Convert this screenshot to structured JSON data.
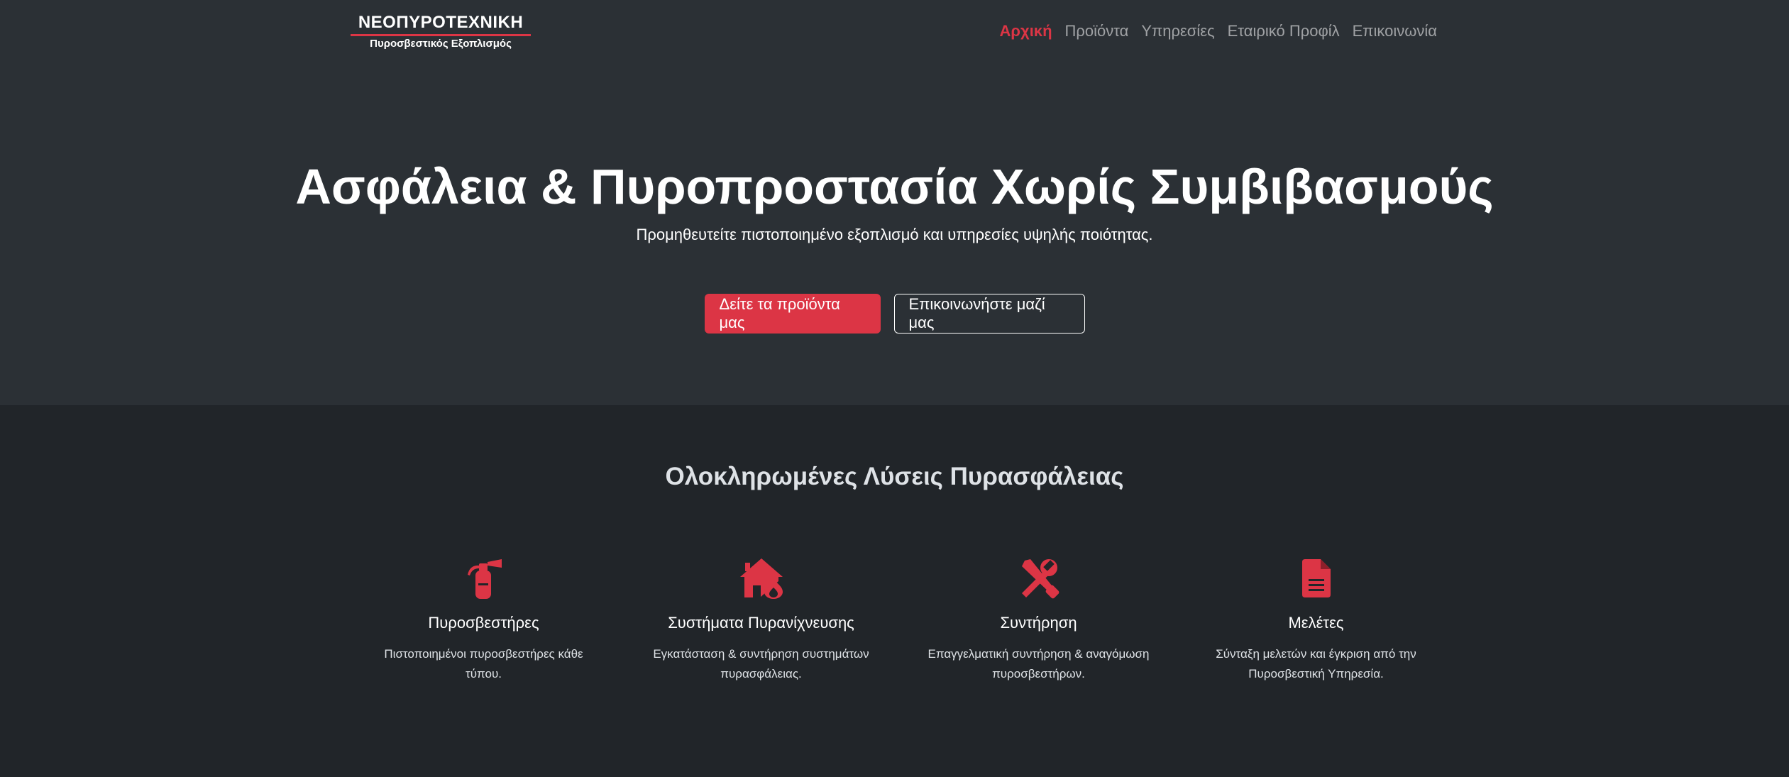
{
  "brand": {
    "name": "ΝΕΟΠΥΡΟΤΕΧΝΙΚΗ",
    "tagline": "Πυροσβεστικός Εξοπλισμός"
  },
  "nav": {
    "items": [
      {
        "label": "Αρχική",
        "active": true
      },
      {
        "label": "Προϊόντα",
        "active": false
      },
      {
        "label": "Υπηρεσίες",
        "active": false
      },
      {
        "label": "Εταιρικό Προφίλ",
        "active": false
      },
      {
        "label": "Επικοινωνία",
        "active": false
      }
    ]
  },
  "hero": {
    "title": "Ασφάλεια & Πυροπροστασία Χωρίς Συμβιβασμούς",
    "subtitle": "Προμηθευτείτε πιστοποιημένο εξοπλισμό και υπηρεσίες υψηλής ποιότητας.",
    "primary_button": "Δείτε τα προϊόντα μας",
    "secondary_button": "Επικοινωνήστε μαζί μας"
  },
  "solutions": {
    "title": "Ολοκληρωμένες Λύσεις Πυρασφάλειας",
    "features": [
      {
        "icon": "fire-extinguisher-icon",
        "title": "Πυροσβεστήρες",
        "description": "Πιστοποιημένοι πυροσβεστήρες κάθε τύπου."
      },
      {
        "icon": "house-fire-icon",
        "title": "Συστήματα Πυρανίχνευσης",
        "description": "Εγκατάσταση & συντήρηση συστημάτων πυρασφάλειας."
      },
      {
        "icon": "tools-icon",
        "title": "Συντήρηση",
        "description": "Επαγγελματική συντήρηση & αναγόμωση πυροσβεστήρων."
      },
      {
        "icon": "file-document-icon",
        "title": "Μελέτες",
        "description": "Σύνταξη μελετών και έγκριση από την Πυροσβεστική Υπηρεσία."
      }
    ]
  },
  "colors": {
    "accent": "#dc3545",
    "hero_background": "#2b3035",
    "page_background": "#212529"
  }
}
